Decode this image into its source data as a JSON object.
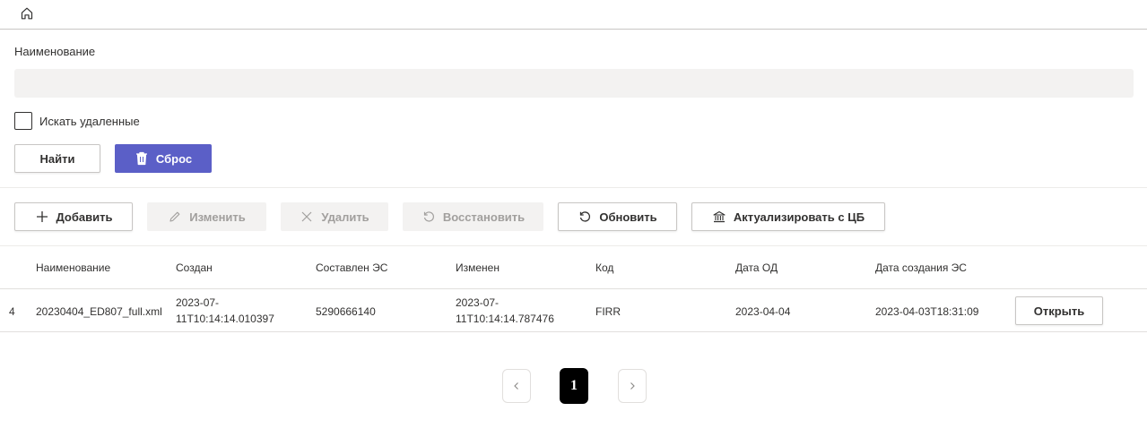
{
  "filter": {
    "name_label": "Наименование",
    "name_value": "",
    "name_placeholder": "",
    "deleted_checkbox_label": "Искать удаленные",
    "deleted_checked": false,
    "find_label": "Найти",
    "reset_label": "Сброс"
  },
  "toolbar": {
    "add_label": "Добавить",
    "edit_label": "Изменить",
    "delete_label": "Удалить",
    "restore_label": "Восстановить",
    "refresh_label": "Обновить",
    "actualize_label": "Актуализировать с ЦБ"
  },
  "table": {
    "columns": [
      "Наименование",
      "Создан",
      "Составлен ЭС",
      "Изменен",
      "Код",
      "Дата ОД",
      "Дата создания ЭС"
    ],
    "rows": [
      {
        "index": "4",
        "name": "20230404_ED807_full.xml",
        "created_line1": "2023-07-",
        "created_line2": "11T10:14:14.010397",
        "composed_es": "5290666140",
        "modified_line1": "2023-07-",
        "modified_line2": "11T10:14:14.787476",
        "code": "FIRR",
        "date_od": "2023-04-04",
        "es_created": "2023-04-03T18:31:09",
        "open_label": "Открыть"
      }
    ]
  },
  "pagination": {
    "current_page": "1"
  },
  "colors": {
    "primary": "#5b5fc7",
    "disabled_bg": "#f3f2f1",
    "input_bg": "#f3f2f1"
  }
}
